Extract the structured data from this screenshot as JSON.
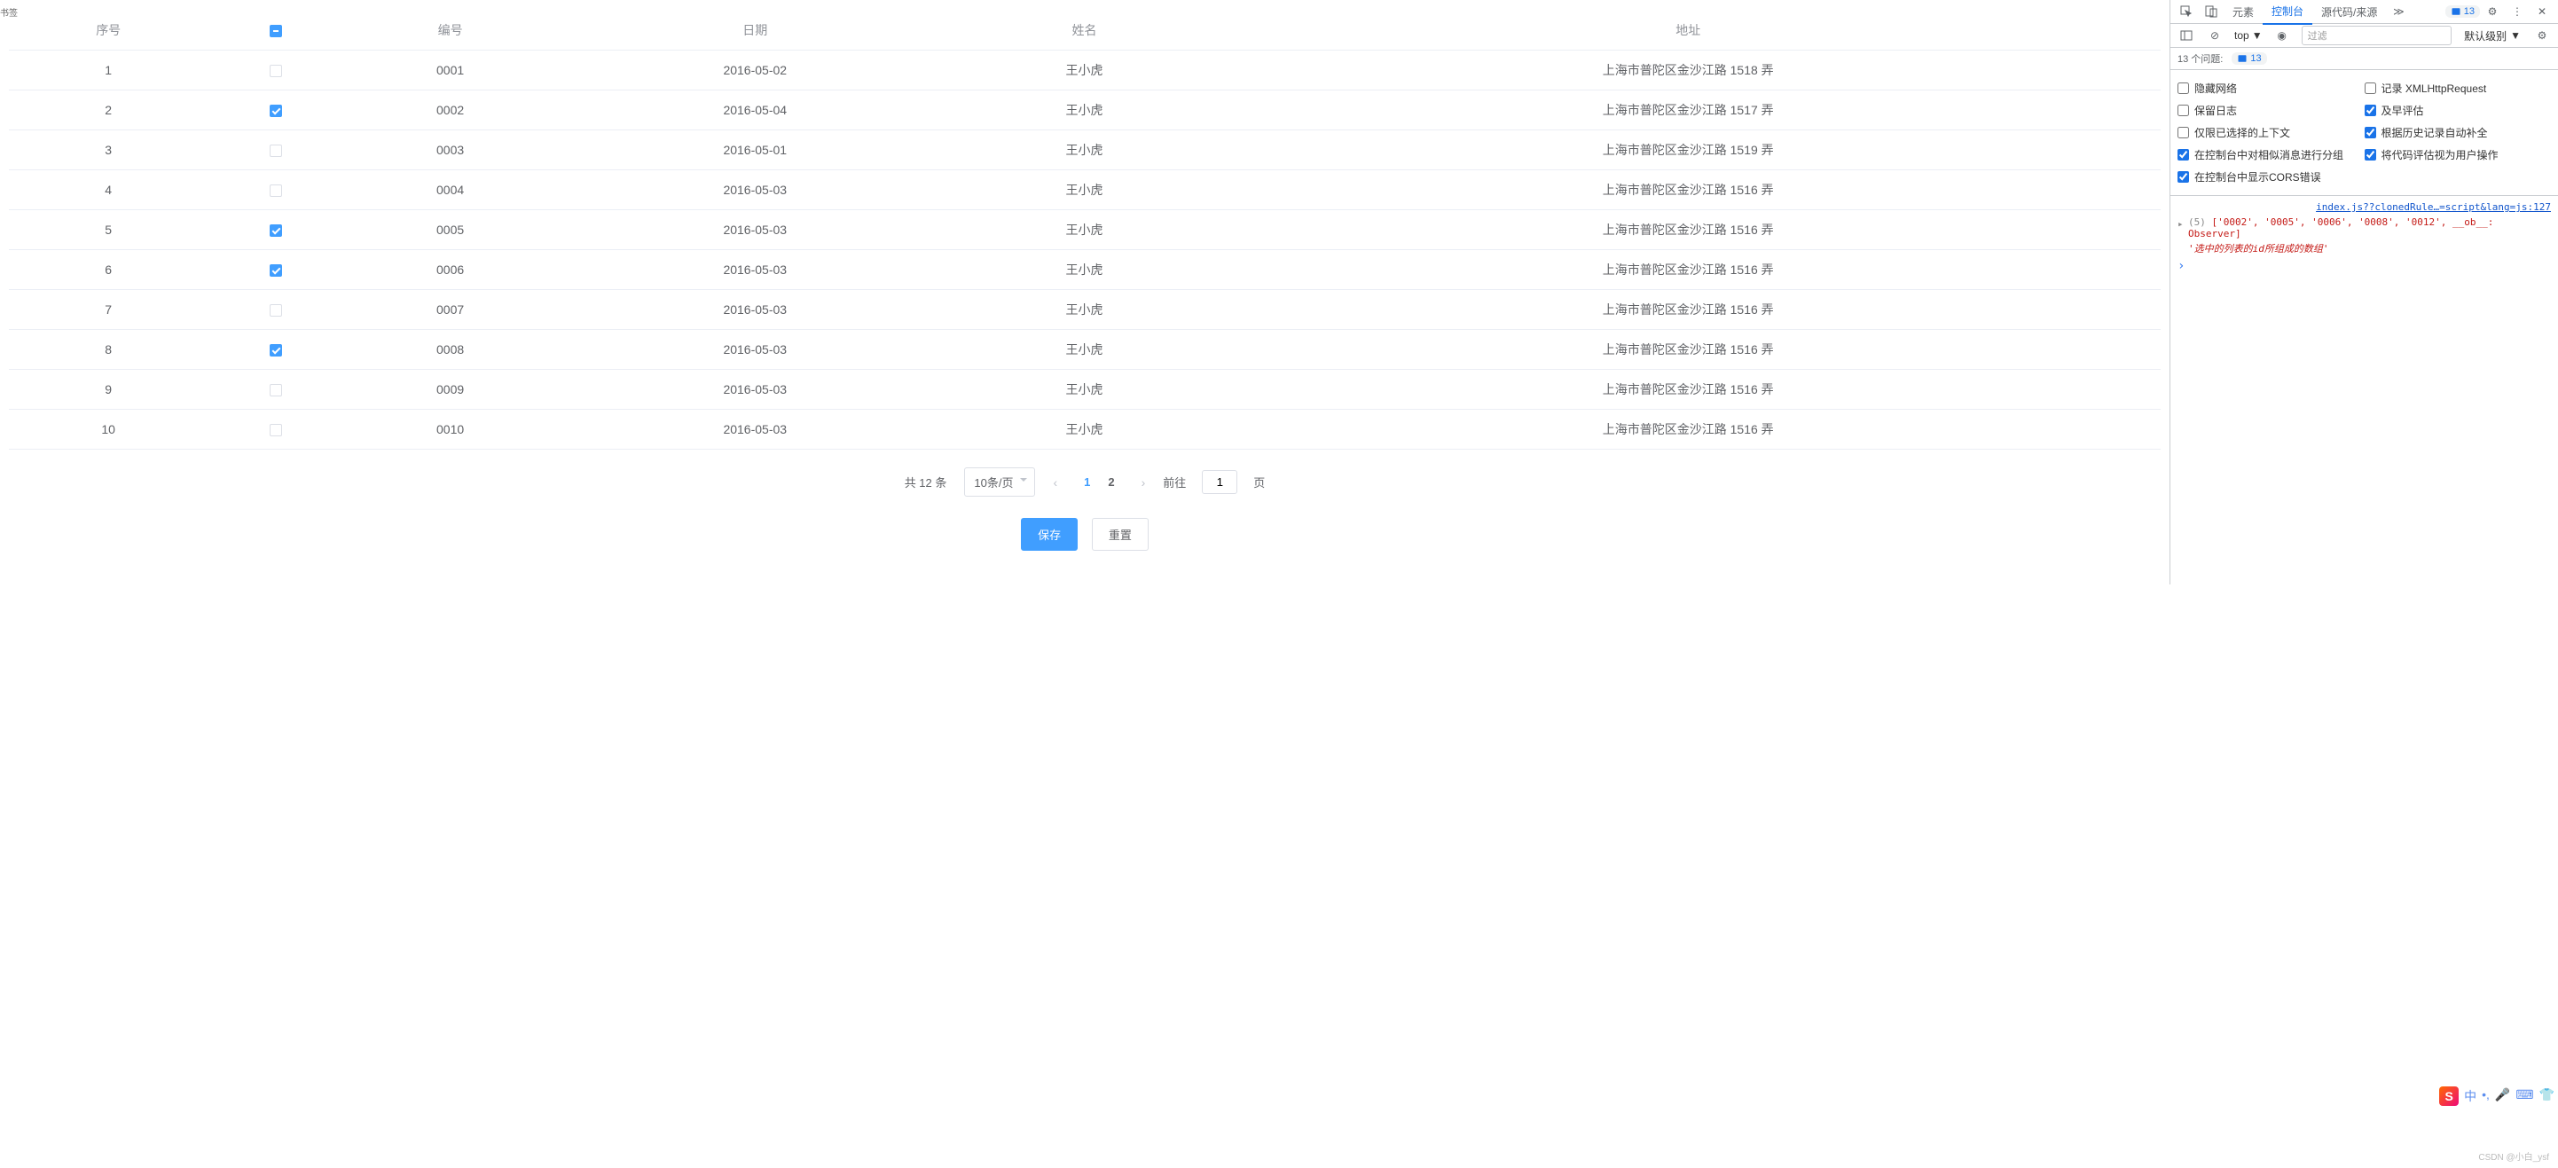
{
  "sidebar_label": "书签",
  "table": {
    "headers": {
      "index": "序号",
      "id": "编号",
      "date": "日期",
      "name": "姓名",
      "address": "地址"
    },
    "rows": [
      {
        "index": "1",
        "checked": false,
        "id": "0001",
        "date": "2016-05-02",
        "name": "王小虎",
        "address": "上海市普陀区金沙江路 1518 弄"
      },
      {
        "index": "2",
        "checked": true,
        "id": "0002",
        "date": "2016-05-04",
        "name": "王小虎",
        "address": "上海市普陀区金沙江路 1517 弄"
      },
      {
        "index": "3",
        "checked": false,
        "id": "0003",
        "date": "2016-05-01",
        "name": "王小虎",
        "address": "上海市普陀区金沙江路 1519 弄"
      },
      {
        "index": "4",
        "checked": false,
        "id": "0004",
        "date": "2016-05-03",
        "name": "王小虎",
        "address": "上海市普陀区金沙江路 1516 弄"
      },
      {
        "index": "5",
        "checked": true,
        "id": "0005",
        "date": "2016-05-03",
        "name": "王小虎",
        "address": "上海市普陀区金沙江路 1516 弄"
      },
      {
        "index": "6",
        "checked": true,
        "id": "0006",
        "date": "2016-05-03",
        "name": "王小虎",
        "address": "上海市普陀区金沙江路 1516 弄"
      },
      {
        "index": "7",
        "checked": false,
        "id": "0007",
        "date": "2016-05-03",
        "name": "王小虎",
        "address": "上海市普陀区金沙江路 1516 弄"
      },
      {
        "index": "8",
        "checked": true,
        "id": "0008",
        "date": "2016-05-03",
        "name": "王小虎",
        "address": "上海市普陀区金沙江路 1516 弄"
      },
      {
        "index": "9",
        "checked": false,
        "id": "0009",
        "date": "2016-05-03",
        "name": "王小虎",
        "address": "上海市普陀区金沙江路 1516 弄"
      },
      {
        "index": "10",
        "checked": false,
        "id": "0010",
        "date": "2016-05-03",
        "name": "王小虎",
        "address": "上海市普陀区金沙江路 1516 弄"
      }
    ]
  },
  "pagination": {
    "total_text": "共 12 条",
    "page_size": "10条/页",
    "pages": [
      "1",
      "2"
    ],
    "active_page": "1",
    "jump_prefix": "前往",
    "jump_value": "1",
    "jump_suffix": "页"
  },
  "buttons": {
    "save": "保存",
    "reset": "重置"
  },
  "devtools": {
    "tabs": {
      "elements": "元素",
      "console": "控制台",
      "sources": "源代码/来源"
    },
    "badge_count": "13",
    "toolbar": {
      "context": "top",
      "filter_placeholder": "过滤",
      "level": "默认级别"
    },
    "issues": {
      "label": "13 个问题:",
      "count": "13"
    },
    "settings": {
      "hide_network": "隐藏网络",
      "log_xhr": "记录 XMLHttpRequest",
      "preserve_log": "保留日志",
      "eager_eval": "及早评估",
      "selected_context": "仅限已选择的上下文",
      "autocomplete_history": "根据历史记录自动补全",
      "group_similar": "在控制台中对相似消息进行分组",
      "user_activation": "将代码评估视为用户操作",
      "show_cors": "在控制台中显示CORS错误"
    },
    "console": {
      "source_link": "index.js??clonedRule…=script&lang=js:127",
      "array_prefix": "(5) ",
      "array_items": "['0002', '0005', '0006', '0008', '0012', __ob__: Observer]",
      "comment": "'选中的列表的id所组成的数组'"
    }
  },
  "ime": {
    "lang": "中"
  },
  "watermark": "CSDN @小白_ysf"
}
